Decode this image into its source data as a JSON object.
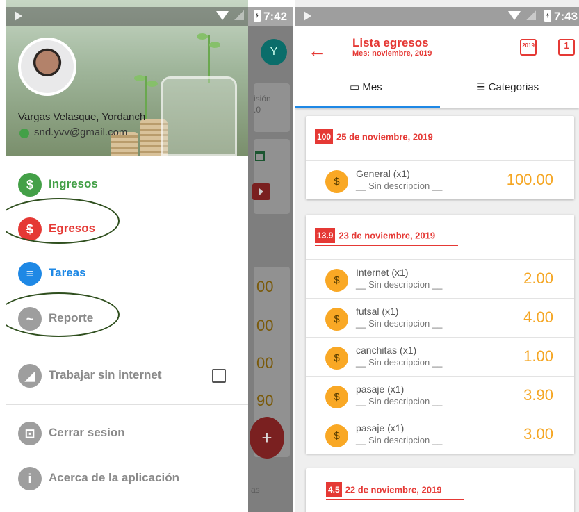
{
  "left": {
    "status_time": "7:42",
    "behind": {
      "avatar_letter": "Y",
      "sub_text": "isión\n.0",
      "numbers": [
        "00",
        "00",
        "00",
        "90"
      ],
      "fab": "+",
      "tail": "as"
    },
    "user": {
      "name": "Vargas Velasque, Yordanch",
      "email": "snd.yvv@gmail.com"
    },
    "menu": [
      {
        "label": "Ingresos",
        "icon": "$",
        "color": "#43a047"
      },
      {
        "label": "Egresos",
        "icon": "$",
        "color": "#e53935"
      },
      {
        "label": "Tareas",
        "icon": "≡",
        "color": "#1e88e5"
      },
      {
        "label": "Reporte",
        "icon": "~",
        "color": "#9e9e9e"
      }
    ],
    "offline": {
      "label": "Trabajar sin internet"
    },
    "logout": {
      "label": "Cerrar sesion"
    },
    "about": {
      "label": "Acerca de la aplicación"
    }
  },
  "right": {
    "status_time": "7:43",
    "title": "Lista egresos",
    "subtitle": "Mes: noviembre, 2019",
    "cal1": "2019",
    "cal2": "1",
    "tabs": [
      "Mes",
      "Categorias"
    ],
    "groups": [
      {
        "total": "100",
        "date": "25 de noviembre, 2019",
        "items": [
          {
            "name": "General  (x1)",
            "desc": "__ Sin descripcion __",
            "amount": "100.00"
          }
        ]
      },
      {
        "total": "13.9",
        "date": "23 de noviembre, 2019",
        "items": [
          {
            "name": "Internet  (x1)",
            "desc": "__ Sin descripcion __",
            "amount": "2.00"
          },
          {
            "name": "futsal (x1)",
            "desc": "__ Sin descripcion __",
            "amount": "4.00"
          },
          {
            "name": "canchitas (x1)",
            "desc": "__ Sin descripcion __",
            "amount": "1.00"
          },
          {
            "name": "pasaje  (x1)",
            "desc": "__ Sin descripcion __",
            "amount": "3.90"
          },
          {
            "name": "pasaje  (x1)",
            "desc": "__ Sin descripcion __",
            "amount": "3.00"
          }
        ]
      },
      {
        "total": "4.5",
        "date": "22 de noviembre, 2019",
        "items": []
      }
    ]
  }
}
